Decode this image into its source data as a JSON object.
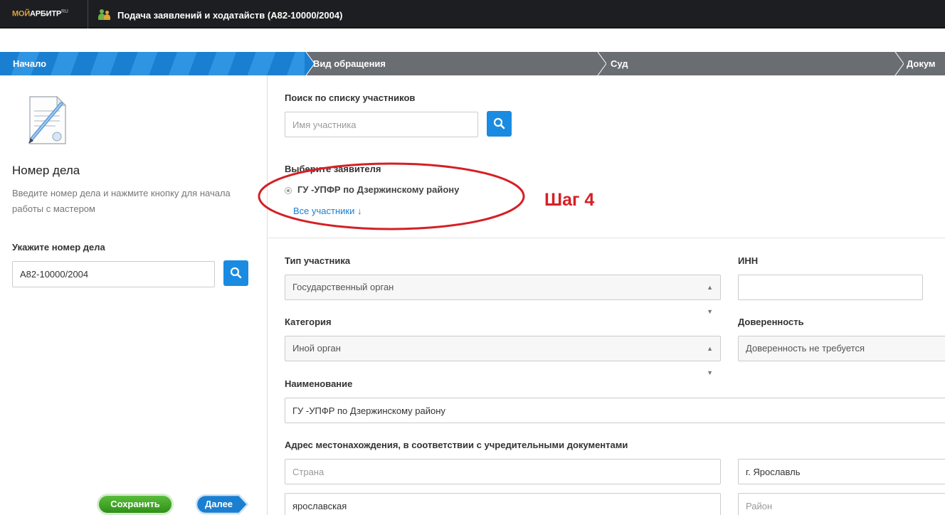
{
  "app": {
    "brand_part1": "МОЙ",
    "brand_part2": "АРБИТР",
    "brand_part3": "RU",
    "title": "Подача заявлений и ходатайств  (А82-10000/2004)"
  },
  "steps": [
    {
      "label": "Начало",
      "active": true
    },
    {
      "label": "Вид обращения",
      "active": false
    },
    {
      "label": "Суд",
      "active": false
    },
    {
      "label": "Докум",
      "active": false
    }
  ],
  "left_panel": {
    "icon": "document-pen-icon",
    "title": "Номер дела",
    "description": "Введите номер дела и нажмите кнопку для начала работы с мастером",
    "case_label": "Укажите номер дела",
    "case_value": "А82-10000/2004",
    "save_label": "Сохранить",
    "next_label": "Далее"
  },
  "search": {
    "label": "Поиск по списку участников",
    "placeholder": "Имя участника"
  },
  "applicant": {
    "label": "Выберите заявителя",
    "name": "ГУ -УПФР по Дзержинскому району",
    "all_link": "Все участники ↓",
    "annotation": "Шаг 4"
  },
  "form": {
    "type_label": "Тип участника",
    "type_value": "Государственный орган",
    "inn_label": "ИНН",
    "inn_value": "",
    "category_label": "Категория",
    "category_value": "Иной орган",
    "proxy_label": "Доверенность",
    "proxy_value": "Доверенность не требуется",
    "name_label": "Наименование",
    "name_value": "ГУ -УПФР по Дзержинскому району",
    "address_label": "Адрес местонахождения, в соответствии с учредительными документами",
    "country_placeholder": "Страна",
    "city_value": "г. Ярославль",
    "region_value": "ярославская",
    "district_placeholder": "Район"
  },
  "colors": {
    "accent": "#1a8be0",
    "annotation": "#d42025",
    "save": "#3fa523"
  }
}
